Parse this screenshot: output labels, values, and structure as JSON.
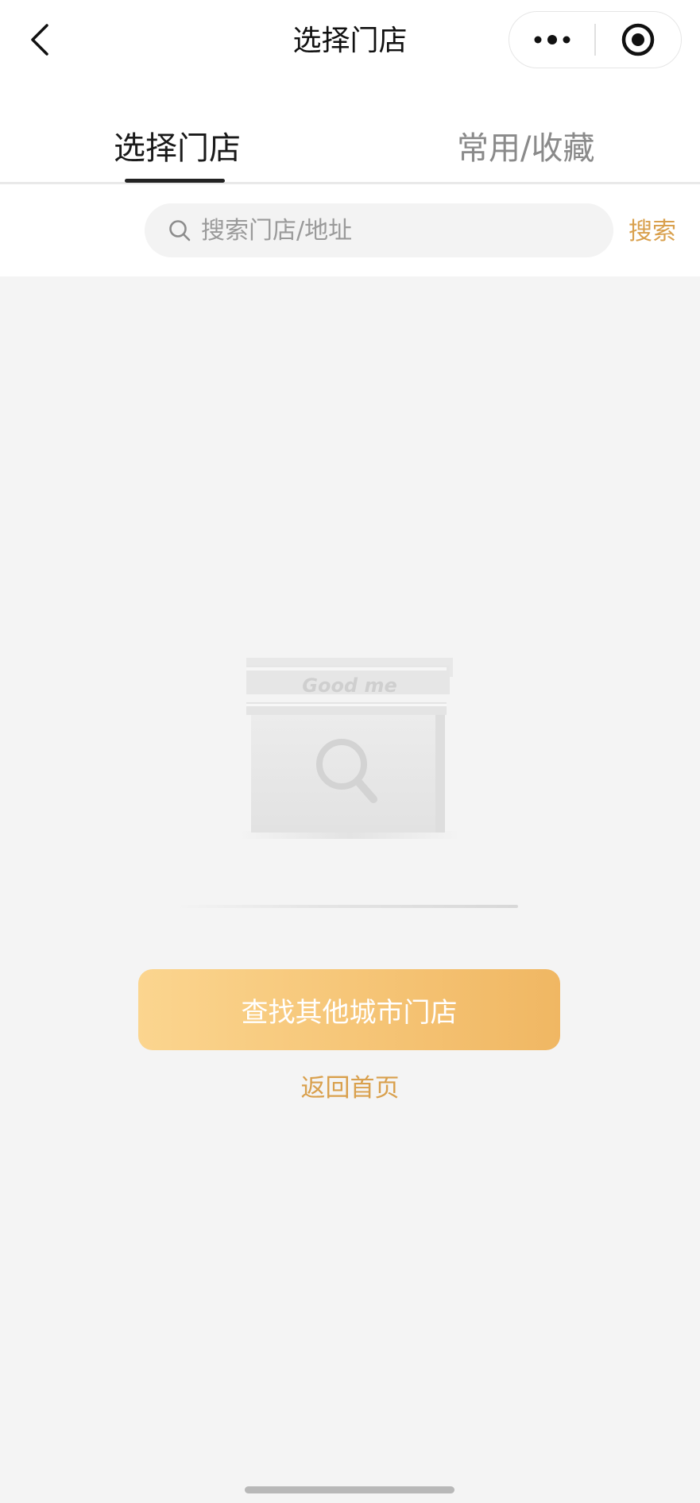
{
  "nav": {
    "title": "选择门店"
  },
  "tabs": [
    {
      "label": "选择门店",
      "active": true
    },
    {
      "label": "常用/收藏",
      "active": false
    }
  ],
  "search": {
    "placeholder": "搜索门店/地址",
    "value": "",
    "submit_label": "搜索"
  },
  "empty_state": {
    "logo_text": "Good me"
  },
  "actions": {
    "find_other_city_label": "查找其他城市门店",
    "back_home_label": "返回首页"
  },
  "colors": {
    "accent": "#d9a04d",
    "button_gradient_start": "#fbd58f",
    "button_gradient_end": "#f0b763",
    "background": "#f4f4f4"
  },
  "icons": {
    "back": "chevron-left-icon",
    "more": "more-dots-icon",
    "close": "target-circle-icon",
    "search": "search-icon"
  }
}
